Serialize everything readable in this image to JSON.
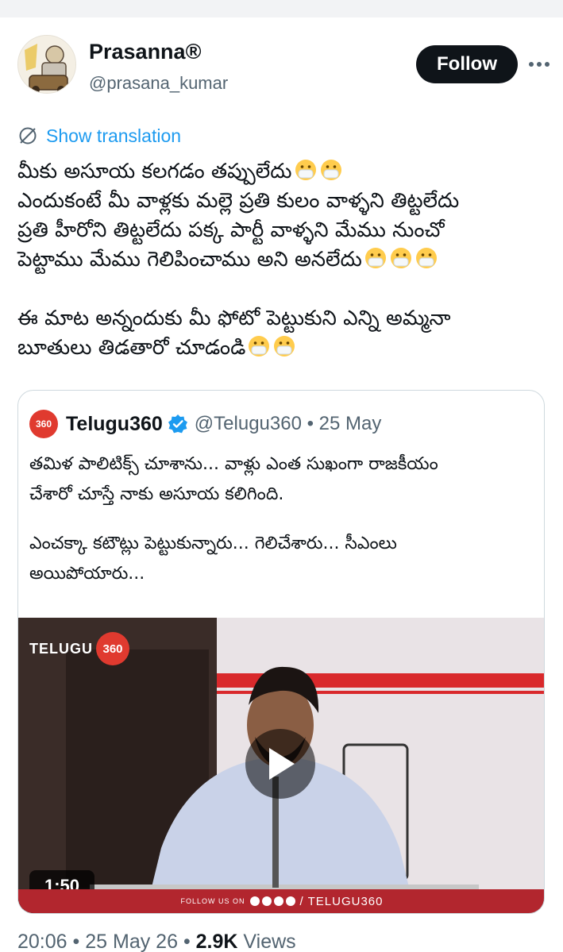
{
  "author": {
    "display_name": "Prasanna®",
    "handle": "@prasana_kumar",
    "avatar_icon": "cartoon-avatar"
  },
  "actions": {
    "follow_label": "Follow",
    "more_icon": "more-icon"
  },
  "translation": {
    "label": "Show translation"
  },
  "tweet": {
    "lines": [
      "మీకు అసూయ కలగడం తప్పులేదు",
      "ఎందుకంటే మీ వాళ్లకు మల్లె ప్రతి కులం వాళ్ళని తిట్టలేదు",
      "ప్రతి హీరోని తిట్టలేదు పక్క పార్టీ వాళ్ళని మేము నుంచో",
      "పెట్టాము మేము గెలిపించాము అని అనలేదు",
      "ఈ మాట అన్నందుకు మీ ఫోటో పెట్టుకుని ఎన్ని అమ్మనా",
      "బూతులు తిడతారో చూడండి"
    ],
    "emoji_icon": "face-with-medical-mask"
  },
  "quoted": {
    "logo_text": "360",
    "name": "Telugu360",
    "verified_icon": "verified-badge-icon",
    "handle_date": "@Telugu360 • 25 May",
    "lines": [
      "తమిళ పాలిటిక్స్ చూశాను... వాళ్లు ఎంత సుఖంగా రాజకీయం",
      "చేశారో చూస్తే నాకు అసూయ కలిగింది.",
      "ఎంచక్కా కటౌట్లు పెట్టుకున్నారు... గెలిచేశారు... సీఎంలు",
      "అయిపోయారు..."
    ],
    "video": {
      "watermark_text": "TELUGU",
      "watermark_badge": "360",
      "duration": "1:50",
      "follow_us": "FOLLOW US ON",
      "strip_handle": "/ TELUGU360"
    }
  },
  "meta": {
    "time": "20:06",
    "date": "25 May 26",
    "views_count": "2.9K",
    "views_label": "Views",
    "separator": "•"
  }
}
